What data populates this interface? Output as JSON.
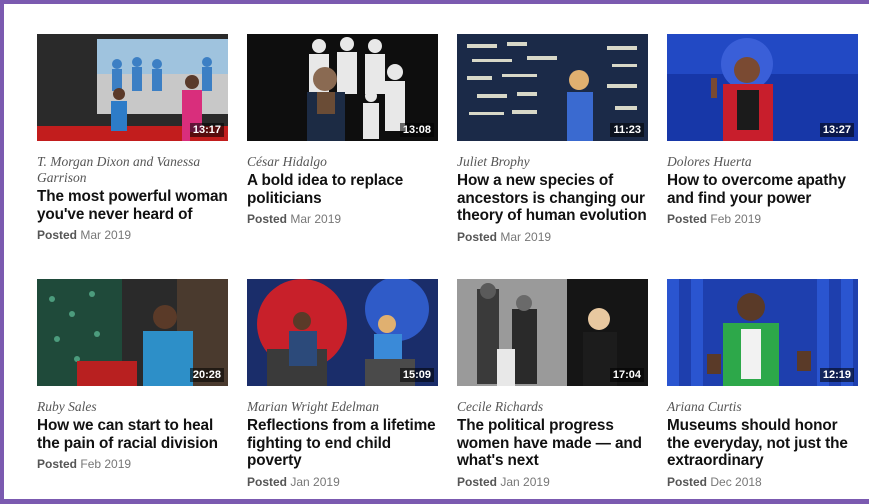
{
  "talks": [
    {
      "speaker": "T. Morgan Dixon and Vanessa Garrison",
      "title": "The most powerful woman you've never heard of",
      "posted_label": "Posted",
      "posted_date": "Mar 2019",
      "duration": "13:17",
      "scene": "rally"
    },
    {
      "speaker": "César Hidalgo",
      "title": "A bold idea to replace politicians",
      "posted_label": "Posted",
      "posted_date": "Mar 2019",
      "duration": "13:08",
      "scene": "figures"
    },
    {
      "speaker": "Juliet Brophy",
      "title": "How a new species of ancestors is changing our theory of human evolution",
      "posted_label": "Posted",
      "posted_date": "Mar 2019",
      "duration": "11:23",
      "scene": "bones"
    },
    {
      "speaker": "Dolores Huerta",
      "title": "How to overcome apathy and find your power",
      "posted_label": "Posted",
      "posted_date": "Feb 2019",
      "duration": "13:27",
      "scene": "blue"
    },
    {
      "speaker": "Ruby Sales",
      "title": "How we can start to heal the pain of racial division",
      "posted_label": "Posted",
      "posted_date": "Feb 2019",
      "duration": "20:28",
      "scene": "seated"
    },
    {
      "speaker": "Marian Wright Edelman",
      "title": "Reflections from a lifetime fighting to end child poverty",
      "posted_label": "Posted",
      "posted_date": "Jan 2019",
      "duration": "15:09",
      "scene": "interview"
    },
    {
      "speaker": "Cecile Richards",
      "title": "The political progress women have made — and what's next",
      "posted_label": "Posted",
      "posted_date": "Jan 2019",
      "duration": "17:04",
      "scene": "photo"
    },
    {
      "speaker": "Ariana Curtis",
      "title": "Museums should honor the everyday, not just the extraordinary",
      "posted_label": "Posted",
      "posted_date": "Dec 2018",
      "duration": "12:19",
      "scene": "green"
    }
  ]
}
